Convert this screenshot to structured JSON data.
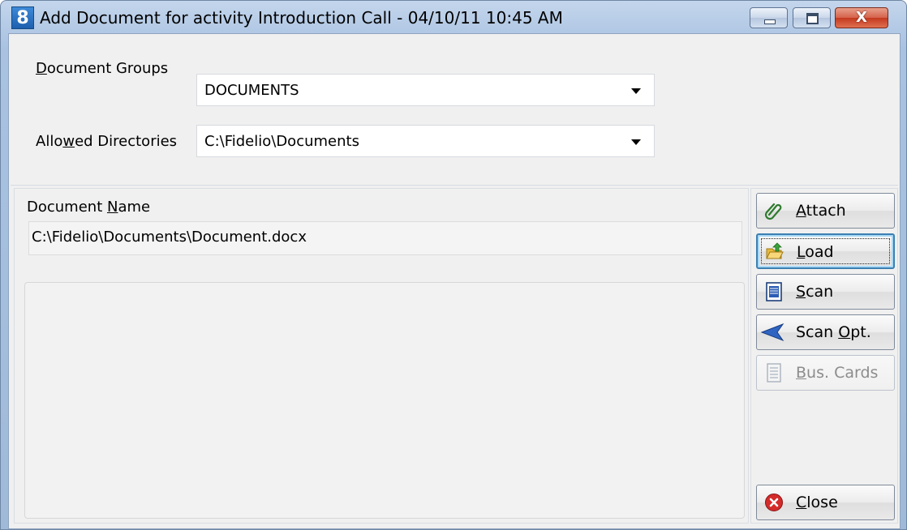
{
  "window": {
    "title": "Add Document for activity Introduction Call - 04/10/11 10:45 AM",
    "app_icon_glyph": "8",
    "close_glyph": "X"
  },
  "form": {
    "document_groups": {
      "label_pre": "",
      "label_ul": "D",
      "label_post": "ocument Groups",
      "value": "DOCUMENTS"
    },
    "allowed_directories": {
      "label_pre": "Allo",
      "label_ul": "w",
      "label_post": "ed Directories",
      "value": "C:\\Fidelio\\Documents"
    },
    "document_name": {
      "label_pre": "Document ",
      "label_ul": "N",
      "label_post": "ame",
      "value": "C:\\Fidelio\\Documents\\Document.docx"
    }
  },
  "buttons": [
    {
      "id": "attach",
      "ul": "A",
      "rest": "ttach",
      "pre": "",
      "icon": "paperclip-icon",
      "enabled": true
    },
    {
      "id": "load",
      "ul": "L",
      "rest": "oad",
      "pre": "",
      "icon": "folder-open-icon",
      "enabled": true,
      "focused": true
    },
    {
      "id": "scan",
      "ul": "S",
      "rest": "can",
      "pre": "",
      "icon": "scan-document-icon",
      "enabled": true
    },
    {
      "id": "scan-opt",
      "pre": "Scan ",
      "ul": "O",
      "rest": "pt.",
      "icon": "scan-options-icon",
      "enabled": true
    },
    {
      "id": "bus-cards",
      "ul": "B",
      "rest": "us. Cards",
      "pre": "",
      "icon": "business-card-icon",
      "enabled": false
    },
    {
      "id": "close",
      "ul": "C",
      "rest": "lose",
      "pre": "",
      "icon": "close-icon",
      "enabled": true
    }
  ],
  "colors": {
    "window_frame": "#b5cbe6",
    "client_bg": "#f0f0f0",
    "focus_border": "#3c7fb1",
    "close_red": "#c4391f"
  }
}
